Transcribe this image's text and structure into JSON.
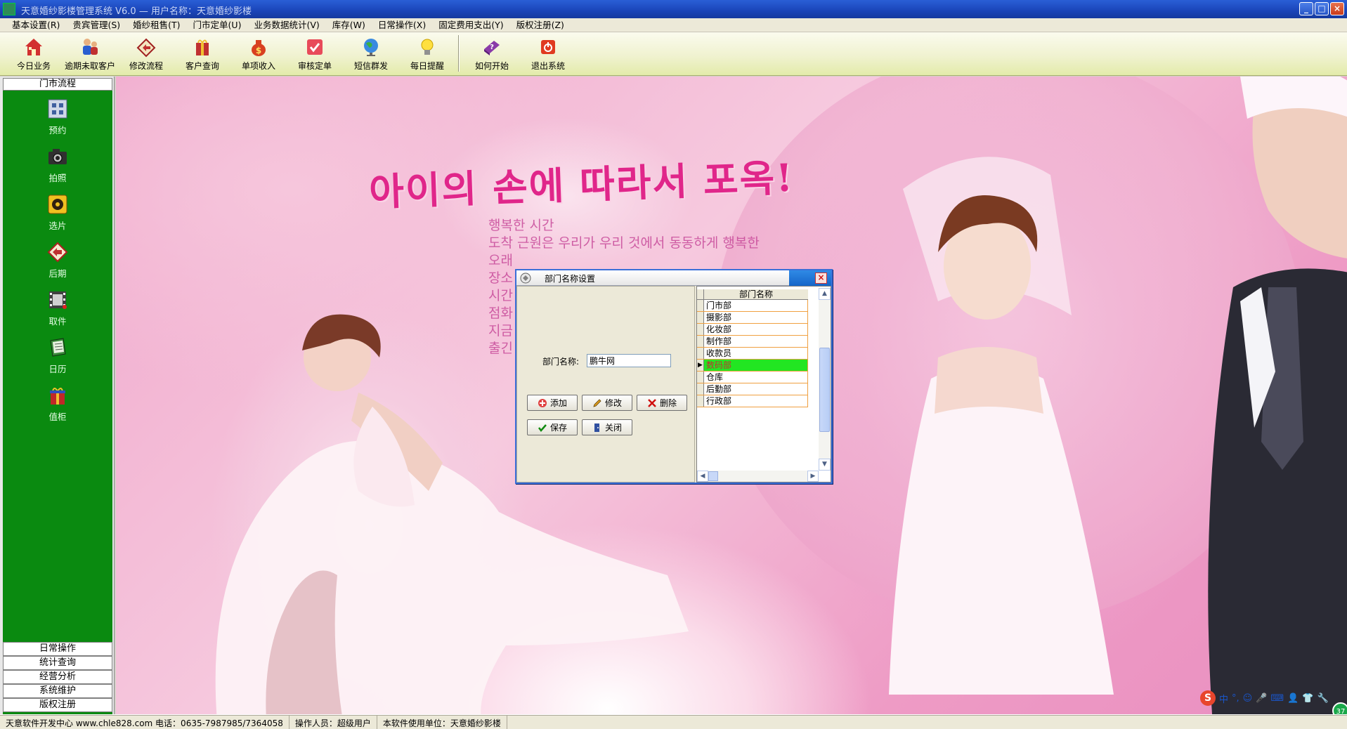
{
  "window": {
    "title": "天意婚纱影楼管理系统 V6.0 — 用户名称：天意婚纱影楼",
    "buttons": {
      "minimize": "_",
      "maximize": "□",
      "close": "×"
    }
  },
  "menubar": [
    "基本设置(R)",
    "贵宾管理(S)",
    "婚纱租售(T)",
    "门市定单(U)",
    "业务数据统计(V)",
    "库存(W)",
    "日常操作(X)",
    "固定费用支出(Y)",
    "版权注册(Z)"
  ],
  "toolbar": [
    {
      "label": "今日业务",
      "icon": "house-icon"
    },
    {
      "label": "逾期未取客户",
      "icon": "people-icon"
    },
    {
      "label": "修改流程",
      "icon": "edit-flow-icon"
    },
    {
      "label": "客户查询",
      "icon": "customer-search-icon"
    },
    {
      "label": "单项收入",
      "icon": "money-bag-icon"
    },
    {
      "label": "审核定单",
      "icon": "check-order-icon"
    },
    {
      "label": "短信群发",
      "icon": "globe-icon"
    },
    {
      "label": "每日提醒",
      "icon": "lightbulb-icon"
    },
    {
      "label": "如何开始",
      "icon": "help-book-icon"
    },
    {
      "label": "退出系统",
      "icon": "power-icon"
    }
  ],
  "sidebar": {
    "header": "门市流程",
    "items": [
      {
        "label": "预约",
        "icon": "calendar-grid-icon"
      },
      {
        "label": "拍照",
        "icon": "camera-icon"
      },
      {
        "label": "选片",
        "icon": "film-reel-icon"
      },
      {
        "label": "后期",
        "icon": "retouch-icon"
      },
      {
        "label": "取件",
        "icon": "film-strip-icon"
      },
      {
        "label": "日历",
        "icon": "notebook-icon"
      },
      {
        "label": "值柜",
        "icon": "gift-box-icon"
      }
    ],
    "footer": [
      "日常操作",
      "统计查询",
      "经营分析",
      "系统维护",
      "版权注册"
    ]
  },
  "background": {
    "headline": "아이의 손에 따라서 포옥!",
    "lines": [
      "행복한 시간",
      "도착 근원은 우리가 우리 것에서 동동하게 행복한",
      "오래",
      "장소",
      "시간",
      "점화",
      "지금",
      "출긴"
    ]
  },
  "dialog": {
    "title": "部门名称设置",
    "close": "×",
    "field_label": "部门名称:",
    "field_value": "鹏牛网",
    "buttons": {
      "add": "添加",
      "modify": "修改",
      "delete": "删除",
      "save": "保存",
      "close": "关闭"
    },
    "grid": {
      "column": "部门名称",
      "rows": [
        "门市部",
        "摄影部",
        "化妆部",
        "制作部",
        "收款员",
        "数码部",
        "仓库",
        "后勤部",
        "行政部"
      ],
      "selected_index": 5,
      "selected_color": "#22e622"
    }
  },
  "statusbar": {
    "developer": "天意软件开发中心 www.chle828.com 电话：0635-7987985/7364058",
    "operator": "操作人员：超级用户",
    "licensee": "本软件使用单位：天意婚纱影楼"
  },
  "tray": {
    "ime_logo": "S",
    "ime_mode": "中",
    "badge": "37"
  },
  "colors": {
    "sidebar_green": "#0a8a10",
    "title_blue": "#1a44b8",
    "accent_pink": "#e0268a"
  }
}
